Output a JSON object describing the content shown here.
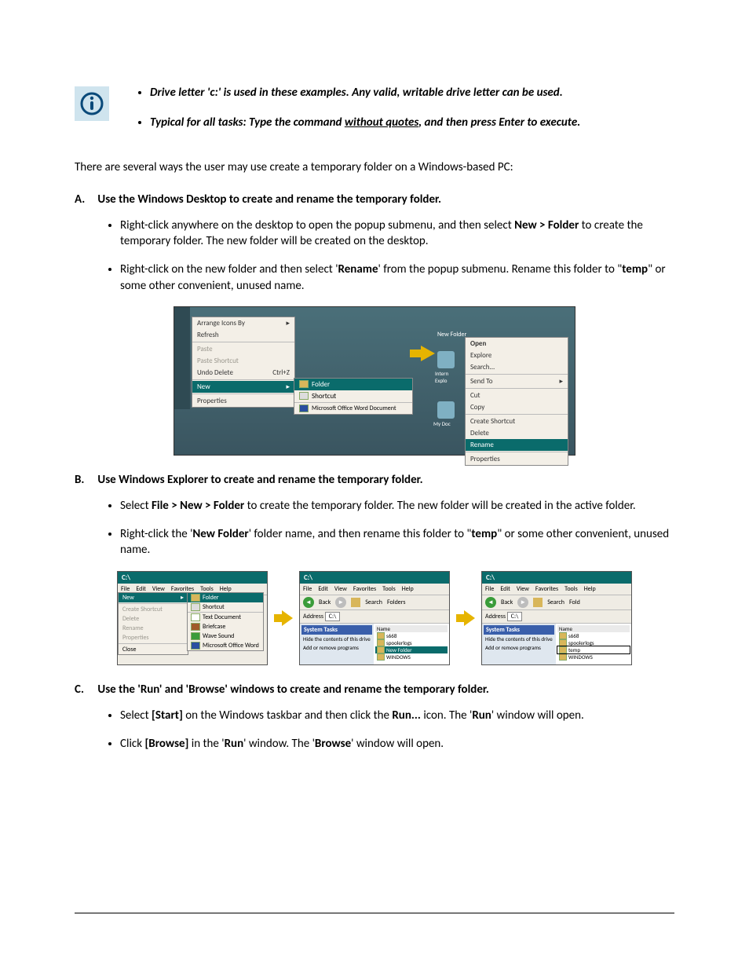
{
  "notes": {
    "bullet1_a": "Drive letter 'c:' is used in these examples. Any valid, writable drive letter can be used.",
    "bullet2_a": "Typical for all tasks: Type the command ",
    "bullet2_u": "without quotes",
    "bullet2_b": ", and then press Enter to execute."
  },
  "intro": "There are several ways the user may use create a temporary folder on a Windows-based PC:",
  "sectionA": {
    "letter": "A.",
    "title": "Use the Windows Desktop to create and rename the temporary folder.",
    "b1_a": "Right-click anywhere on the desktop to open the popup submenu, and then select ",
    "b1_bold": "New > Folder",
    "b1_b": " to create the temporary folder. The new folder will be created on the desktop.",
    "b2_a": "Right-click on the new folder and then select '",
    "b2_bold1": "Rename",
    "b2_b": "' from the popup submenu. Rename this folder to \"",
    "b2_bold2": "temp",
    "b2_c": "\" or some other convenient, unused name."
  },
  "fig1": {
    "menu1": {
      "arrange": "Arrange Icons By",
      "refresh": "Refresh",
      "paste": "Paste",
      "paste_sc": "Paste Shortcut",
      "undo": "Undo Delete",
      "undo_k": "Ctrl+Z",
      "new": "New",
      "props": "Properties"
    },
    "submenu": {
      "folder": "Folder",
      "shortcut": "Shortcut",
      "word": "Microsoft Office Word Document"
    },
    "newfolder": "New Folder",
    "intern": "Intern",
    "explo": "Explo",
    "mydoc": "My Doc",
    "menu2": {
      "open": "Open",
      "explore": "Explore",
      "search": "Search...",
      "sendto": "Send To",
      "cut": "Cut",
      "copy": "Copy",
      "create_sc": "Create Shortcut",
      "delete": "Delete",
      "rename": "Rename",
      "props": "Properties"
    }
  },
  "sectionB": {
    "letter": "B.",
    "title": "Use Windows Explorer to create and rename the temporary folder.",
    "b1_a": "Select ",
    "b1_bold": "File > New > Folder",
    "b1_b": " to create the temporary folder. The new folder will be created in the active folder.",
    "b2_a": "Right-click the '",
    "b2_bold1": "New Folder",
    "b2_b": "' folder name, and then rename this folder to \"",
    "b2_bold2": "temp",
    "b2_c": "\" or some other convenient, unused name."
  },
  "fig2": {
    "title": "C:\\",
    "menus": {
      "file": "File",
      "edit": "Edit",
      "view": "View",
      "fav": "Favorites",
      "tools": "Tools",
      "help": "Help"
    },
    "back": "Back",
    "search": "Search",
    "folders": "Folders",
    "fold": "Fold",
    "addr_lbl": "Address",
    "addr_val": "C:\\",
    "tasks_hd": "System Tasks",
    "task1": "Hide the contents of this drive",
    "task2": "Add or remove programs",
    "col_name": "Name",
    "f1": "s668",
    "f2": "spoolerlogs",
    "f_new": "New Folder",
    "f_temp": "temp",
    "f_win": "WINDOWS",
    "filemenu": {
      "new": "New",
      "create_sc": "Create Shortcut",
      "delete": "Delete",
      "rename": "Rename",
      "props": "Properties",
      "close": "Close"
    },
    "newmenu": {
      "folder": "Folder",
      "shortcut": "Shortcut",
      "text": "Text Document",
      "brief": "Briefcase",
      "wave": "Wave Sound",
      "word": "Microsoft Office Word"
    }
  },
  "sectionC": {
    "letter": "C.",
    "title": "Use the 'Run' and 'Browse' windows to create and rename the temporary folder.",
    "b1_a": "Select ",
    "b1_bold1": "[Start]",
    "b1_b": " on the Windows taskbar and then click the ",
    "b1_bold2": "Run...",
    "b1_c": " icon. The '",
    "b1_bold3": "Run",
    "b1_d": "' window will open.",
    "b2_a": "Click ",
    "b2_bold1": "[Browse]",
    "b2_b": " in the '",
    "b2_bold2": "Run",
    "b2_c": "' window. The '",
    "b2_bold3": "Browse",
    "b2_d": "' window will open."
  }
}
